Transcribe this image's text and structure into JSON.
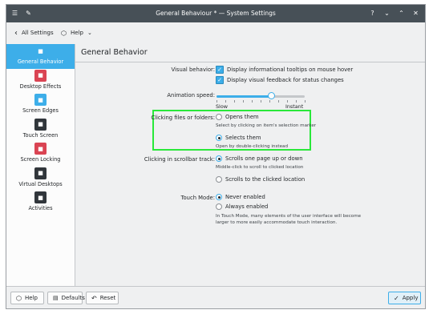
{
  "window": {
    "title": "General Behaviour * — System Settings"
  },
  "toolbar": {
    "back_label": "All Settings",
    "help_label": "Help"
  },
  "sidebar": {
    "items": [
      {
        "label": "General Behavior",
        "icon": "general-behavior-icon",
        "color": "#3daee9",
        "selected": true
      },
      {
        "label": "Desktop Effects",
        "icon": "desktop-effects-icon",
        "color": "#da4453"
      },
      {
        "label": "Screen Edges",
        "icon": "screen-edges-icon",
        "color": "#3daee9"
      },
      {
        "label": "Touch Screen",
        "icon": "touch-screen-icon",
        "color": "#31363b"
      },
      {
        "label": "Screen Locking",
        "icon": "screen-locking-icon",
        "color": "#da4453"
      },
      {
        "label": "Virtual Desktops",
        "icon": "virtual-desktops-icon",
        "color": "#31363b"
      },
      {
        "label": "Activities",
        "icon": "activities-icon",
        "color": "#31363b"
      }
    ]
  },
  "content": {
    "title": "General Behavior",
    "visual_behavior": {
      "label": "Visual behavior:",
      "tooltips_label": "Display informational tooltips on mouse hover",
      "feedback_label": "Display visual feedback for status changes",
      "tooltips_checked": true,
      "feedback_checked": true
    },
    "animation_speed": {
      "label": "Animation speed:",
      "min_label": "Slow",
      "max_label": "Instant",
      "value_fraction": 0.62
    },
    "clicking_files": {
      "label": "Clicking files or folders:",
      "opens_label": "Opens them",
      "opens_hint": "Select by clicking on item's selection marker",
      "selects_label": "Selects them",
      "selects_hint": "Open by double-clicking instead",
      "selected": "selects"
    },
    "scrollbar": {
      "label": "Clicking in scrollbar track:",
      "page_label": "Scrolls one page up or down",
      "page_hint": "Middle-click to scroll to clicked location",
      "location_label": "Scrolls to the clicked location",
      "selected": "page"
    },
    "touch_mode": {
      "label": "Touch Mode:",
      "never_label": "Never enabled",
      "always_label": "Always enabled",
      "hint_line1": "In Touch Mode, many elements of the user interface will become",
      "hint_line2": "larger to more easily accommodate touch interaction.",
      "selected": "never"
    },
    "highlight_color": "#29e83a"
  },
  "footer": {
    "help_label": "Help",
    "defaults_label": "Defaults",
    "reset_label": "Reset",
    "apply_label": "Apply"
  }
}
